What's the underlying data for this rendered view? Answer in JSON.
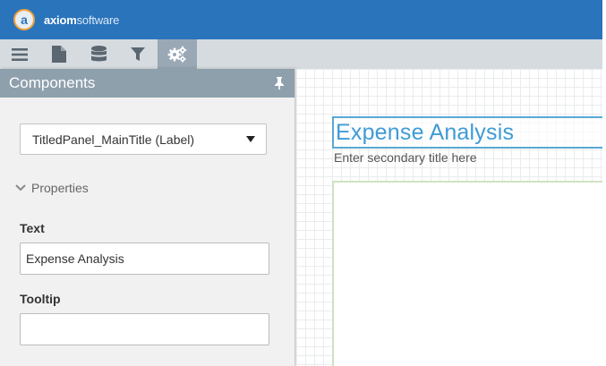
{
  "header": {
    "logo_letter": "a",
    "brand_bold": "axiom",
    "brand_light": "software"
  },
  "toolbar": {
    "buttons": [
      {
        "icon": "hamburger-menu-icon",
        "active": false
      },
      {
        "icon": "document-icon",
        "active": false
      },
      {
        "icon": "database-icon",
        "active": false
      },
      {
        "icon": "filter-icon",
        "active": false
      },
      {
        "icon": "gears-icon",
        "active": true
      }
    ]
  },
  "panel": {
    "title": "Components",
    "component_select": {
      "value": "TitledPanel_MainTitle (Label)"
    },
    "section_label": "Properties",
    "text_field": {
      "label": "Text",
      "value": "Expense Analysis",
      "placeholder": ""
    },
    "tooltip_field": {
      "label": "Tooltip",
      "value": "",
      "placeholder": ""
    }
  },
  "canvas": {
    "main_title": "Expense Analysis",
    "secondary_title": "Enter secondary title here"
  },
  "colors": {
    "header_bg": "#2a74bc",
    "toolbar_bg": "#d6dbe0",
    "toolbar_active": "#9aa8b5",
    "panel_header_bg": "#8fa0ad",
    "title_accent": "#3f9bd5"
  }
}
